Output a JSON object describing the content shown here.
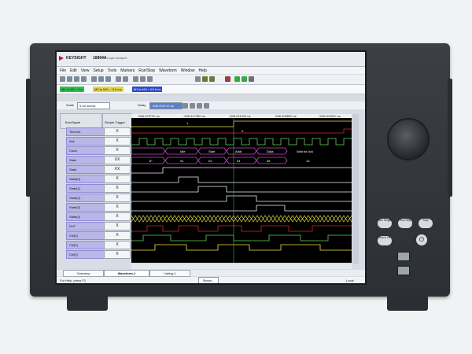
{
  "window": {
    "brand": "KEYSIGHT",
    "model": "16864A",
    "subtitle": "Logic Analyzer"
  },
  "menu": [
    "File",
    "Edit",
    "View",
    "Setup",
    "Tools",
    "Markers",
    "Run/Stop",
    "Waveform",
    "Window",
    "Help"
  ],
  "markers": [
    {
      "from": "M1",
      "to": "M2",
      "value": "= 0 s",
      "color": "#2fbf4f"
    },
    {
      "from": "M2",
      "to": "M3",
      "value": "= -3.6 ms",
      "color": "#e4d44a"
    },
    {
      "from": "M3",
      "to": "M4",
      "value": "= 63.6 ns",
      "color": "#2b49c8"
    }
  ],
  "controls": {
    "scale_label": "Scale",
    "scale_value": "5.18 ms/div",
    "delay_label": "Delay",
    "delay_value": "-536.002710 us"
  },
  "columns": {
    "bus_signal": "Bus/Signal",
    "simple_trigger": "Simple Trigger"
  },
  "time_labels": [
    "-536.023730 us",
    "-536.017330 us",
    "-536.011030 us",
    "-536.005830 us",
    "-536.000900 us"
  ],
  "signals": [
    {
      "name": "Timeout",
      "trigger": "X"
    },
    {
      "name": "Ack",
      "trigger": "X"
    },
    {
      "name": "Clock",
      "trigger": "X"
    },
    {
      "name": "State",
      "trigger": "XX"
    },
    {
      "name": "State",
      "trigger": "XX"
    },
    {
      "name": "State[0]",
      "trigger": "X"
    },
    {
      "name": "State[1]",
      "trigger": "X"
    },
    {
      "name": "State[2]",
      "trigger": "X"
    },
    {
      "name": "State[3]",
      "trigger": "X"
    },
    {
      "name": "State[4]",
      "trigger": "X"
    },
    {
      "name": "DUT",
      "trigger": "X"
    },
    {
      "name": "Ctrl[0]",
      "trigger": "X"
    },
    {
      "name": "Ctrl[1]",
      "trigger": "X"
    },
    {
      "name": "Ctrl[2]",
      "trigger": "X"
    }
  ],
  "bus_labels": {
    "state_names": [
      "Idle",
      "Start",
      "Addr",
      "Data",
      "Wait for Ack"
    ],
    "state_values": [
      "1F",
      "01",
      "02",
      "04",
      "08",
      "13"
    ]
  },
  "tabs": [
    "Overview",
    "Waveform-1",
    "Listing-1"
  ],
  "status": {
    "left": "For Help, press F1",
    "button": "Status...",
    "right": "Local"
  },
  "panel_buttons": [
    "Run Single",
    "Run Rep",
    "Stop",
    "Touch Off"
  ],
  "colors": {
    "accent": "#c8102e",
    "trace_yellow": "#f2e64a",
    "trace_purple": "#c44ac6",
    "trace_red": "#d62424",
    "trace_green": "#5fd15f",
    "trace_white": "#f0f0f0"
  }
}
